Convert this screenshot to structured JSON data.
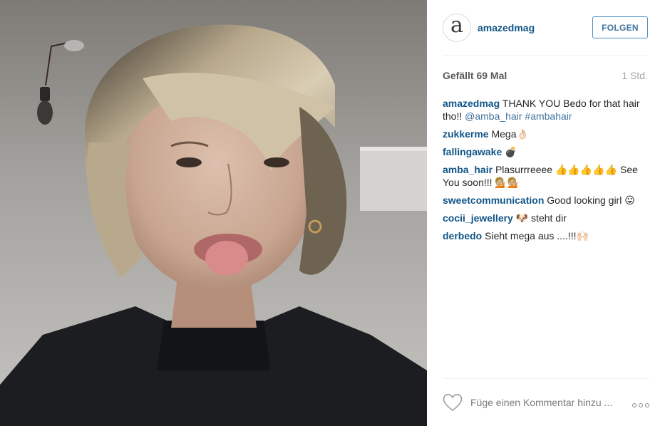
{
  "post": {
    "photo": {
      "subject": "selfie-portrait"
    },
    "header": {
      "avatar_letter": "a",
      "username": "amazedmag",
      "follow_label": "FOLGEN"
    },
    "stats": {
      "likes": "Gefällt 69 Mal",
      "time": "1 Std."
    },
    "comments": [
      {
        "user": "amazedmag",
        "text": "THANK YOU Bedo for that hair tho!!",
        "mention": "@amba_hair",
        "hashtag": "#ambahair"
      },
      {
        "user": "zukkerme",
        "text": "Mega👌🏻"
      },
      {
        "user": "fallingawake",
        "text": "💣"
      },
      {
        "user": "amba_hair",
        "text": "Plasurrreeee 👍👍👍👍👍 See You soon!!! 💁🏼💁🏼"
      },
      {
        "user": "sweetcommunication",
        "text": "Good looking girl 😛"
      },
      {
        "user": "cocii_jewellery",
        "text": "🐶 steht dir"
      },
      {
        "user": "derbedo",
        "text": "Sieht mega aus ....!!!🙌🏻"
      }
    ],
    "footer": {
      "comment_placeholder": "Füge einen Kommentar hinzu ...",
      "like_icon": "heart-icon",
      "more_icon": "more-options-icon"
    },
    "colors": {
      "username": "#125688",
      "link": "#3f729b",
      "follow_border": "#4e8cc4"
    }
  }
}
